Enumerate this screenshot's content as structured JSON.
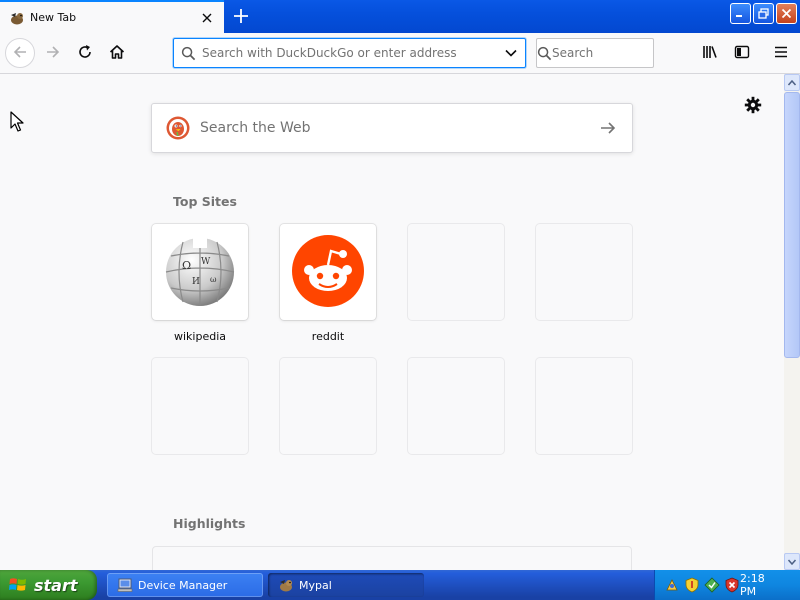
{
  "tab": {
    "title": "New Tab",
    "active": true
  },
  "nav": {
    "url_placeholder": "Search with DuckDuckGo or enter address",
    "search_placeholder": "Search"
  },
  "newtab": {
    "search_placeholder": "Search the Web",
    "top_sites_title": "Top Sites",
    "top_sites": [
      {
        "label": "wikipedia",
        "icon": "wikipedia-icon"
      },
      {
        "label": "reddit",
        "icon": "reddit-icon"
      }
    ],
    "highlights_title": "Highlights"
  },
  "colors": {
    "accent": "#0a84ff",
    "reddit": "#ff4500",
    "duckduckgo": "#de5833",
    "xp_blue": "#245edb",
    "xp_start_green": "#3c9a32"
  },
  "taskbar": {
    "start_label": "start",
    "tasks": [
      {
        "label": "Device Manager",
        "icon": "device-manager-icon",
        "active": false
      },
      {
        "label": "Mypal",
        "icon": "mypal-icon",
        "active": true
      }
    ],
    "clock": "2:18 PM"
  }
}
